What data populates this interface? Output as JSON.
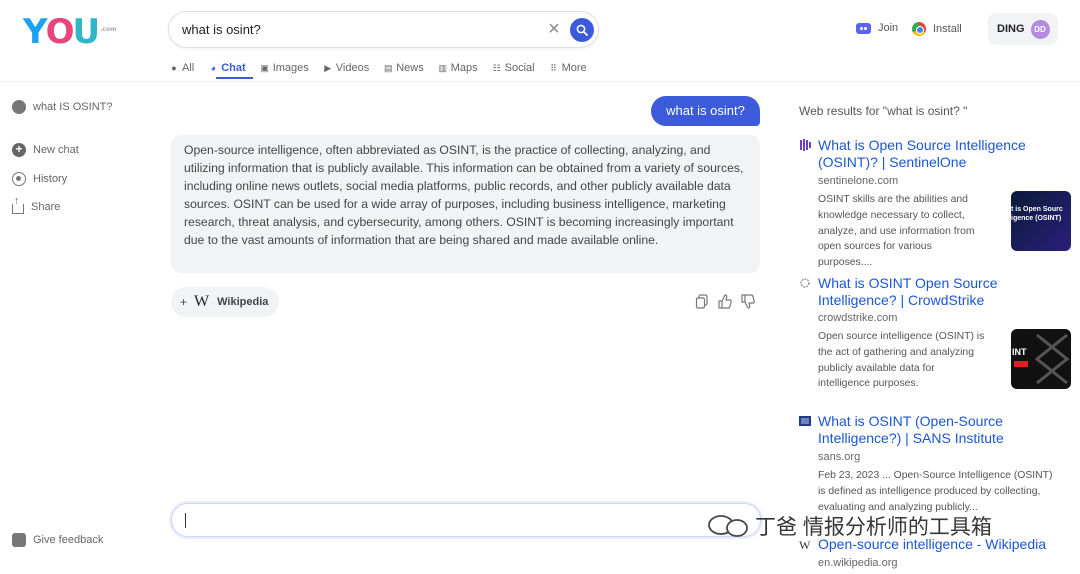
{
  "header": {
    "logo": "YOU",
    "search_query": "what is osint?",
    "tabs": [
      {
        "label": "All",
        "icon": "all-icon"
      },
      {
        "label": "Chat",
        "icon": "chat-icon",
        "active": true
      },
      {
        "label": "Images",
        "icon": "images-icon"
      },
      {
        "label": "Videos",
        "icon": "videos-icon"
      },
      {
        "label": "News",
        "icon": "news-icon"
      },
      {
        "label": "Maps",
        "icon": "maps-icon"
      },
      {
        "label": "Social",
        "icon": "social-icon"
      },
      {
        "label": "More",
        "icon": "more-grid-icon"
      }
    ],
    "join_label": "Join",
    "install_label": "Install",
    "user_name": "DING",
    "user_initials": "DD"
  },
  "sidebar": {
    "current_chat": "what IS OSINT?",
    "new_chat": "New chat",
    "history": "History",
    "share": "Share",
    "feedback": "Give feedback"
  },
  "chat": {
    "user_message": "what is osint?",
    "answer": "Open-source intelligence, often abbreviated as OSINT, is the practice of collecting, analyzing, and utilizing information that is publicly available. This information can be obtained from a variety of sources, including online news outlets, social media platforms, public records, and other publicly available data sources. OSINT can be used for a wide array of purposes, including business intelligence, marketing research, threat analysis, and cybersecurity, among others. OSINT is becoming increasingly important due to the vast amounts of information that are being shared and made available online.",
    "source_label": "Wikipedia",
    "input_value": ""
  },
  "web_results": {
    "heading": "Web results for \"what is osint? \"",
    "items": [
      {
        "title": "What is Open Source Intelligence (OSINT)? | SentinelOne",
        "domain": "sentinelone.com",
        "snippet": "OSINT skills are the abilities and knowledge necessary to collect, analyze, and use information from open sources for various purposes....",
        "thumb_text": "t is Open Sourc igence (OSINT)"
      },
      {
        "title": "What is OSINT Open Source Intelligence? | CrowdStrike",
        "domain": "crowdstrike.com",
        "snippet": "Open source intelligence (OSINT) is the act of gathering and analyzing publicly available data for intelligence purposes.",
        "thumb_text": "INT"
      },
      {
        "title": "What is OSINT (Open-Source Intelligence?) | SANS Institute",
        "domain": "sans.org",
        "snippet": "Feb 23, 2023 ... Open-Source Intelligence (OSINT) is defined as intelligence produced by collecting, evaluating and analyzing publicly..."
      },
      {
        "title": "Open-source intelligence - Wikipedia",
        "domain": "en.wikipedia.org"
      }
    ]
  },
  "watermark": "丁爸 情报分析师的工具箱",
  "colors": {
    "accent": "#3b5bdb",
    "link": "#1a56d6",
    "bubble": "#f2f3f5"
  }
}
